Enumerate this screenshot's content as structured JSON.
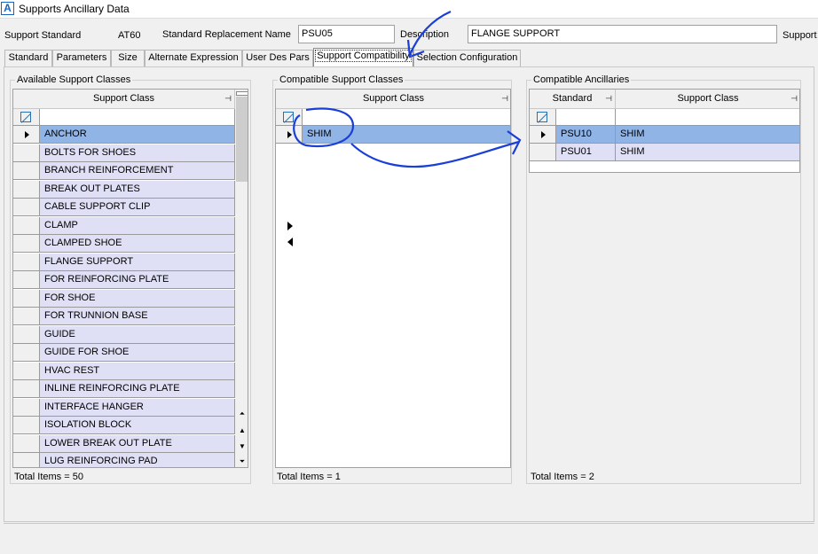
{
  "window": {
    "title": "Supports Ancillary Data",
    "icon": "app-logo-icon"
  },
  "header": {
    "support_standard_label": "Support Standard",
    "support_standard_value": "AT60",
    "replacement_name_label": "Standard Replacement Name",
    "replacement_name_value": "PSU05",
    "description_label": "Description",
    "description_value": "FLANGE SUPPORT",
    "support_cut_label": "Support"
  },
  "tabs": [
    {
      "label": "Standard",
      "active": false
    },
    {
      "label": "Parameters",
      "active": false
    },
    {
      "label": "Size",
      "active": false
    },
    {
      "label": "Alternate Expression",
      "active": false
    },
    {
      "label": "User Des Pars",
      "active": false
    },
    {
      "label": "Support Compatibility",
      "active": true
    },
    {
      "label": "Selection Configuration",
      "active": false
    }
  ],
  "available": {
    "title": "Available Support Classes",
    "column": "Support Class",
    "selected_index": 0,
    "items": [
      "ANCHOR",
      "BOLTS FOR SHOES",
      "BRANCH REINFORCEMENT",
      "BREAK OUT PLATES",
      "CABLE SUPPORT CLIP",
      "CLAMP",
      "CLAMPED SHOE",
      "FLANGE SUPPORT",
      "FOR REINFORCING PLATE",
      "FOR SHOE",
      "FOR TRUNNION BASE",
      "GUIDE",
      "GUIDE FOR SHOE",
      "HVAC REST",
      "INLINE REINFORCING PLATE",
      "INTERFACE HANGER",
      "ISOLATION BLOCK",
      "LOWER BREAK OUT PLATE",
      "LUG REINFORCING PAD"
    ],
    "total": "Total Items = 50"
  },
  "compatible": {
    "title": "Compatible Support Classes",
    "column": "Support Class",
    "items": [
      "SHIM"
    ],
    "total": "Total Items = 1"
  },
  "ancillaries": {
    "title": "Compatible Ancillaries",
    "columns": [
      "Standard",
      "Support Class"
    ],
    "rows": [
      [
        "PSU10",
        "SHIM"
      ],
      [
        "PSU01",
        "SHIM"
      ]
    ],
    "total": "Total Items = 2"
  },
  "colors": {
    "selected_row": "#90b4e6",
    "row": "#dfdff5",
    "annotation": "#1a3fd8"
  }
}
